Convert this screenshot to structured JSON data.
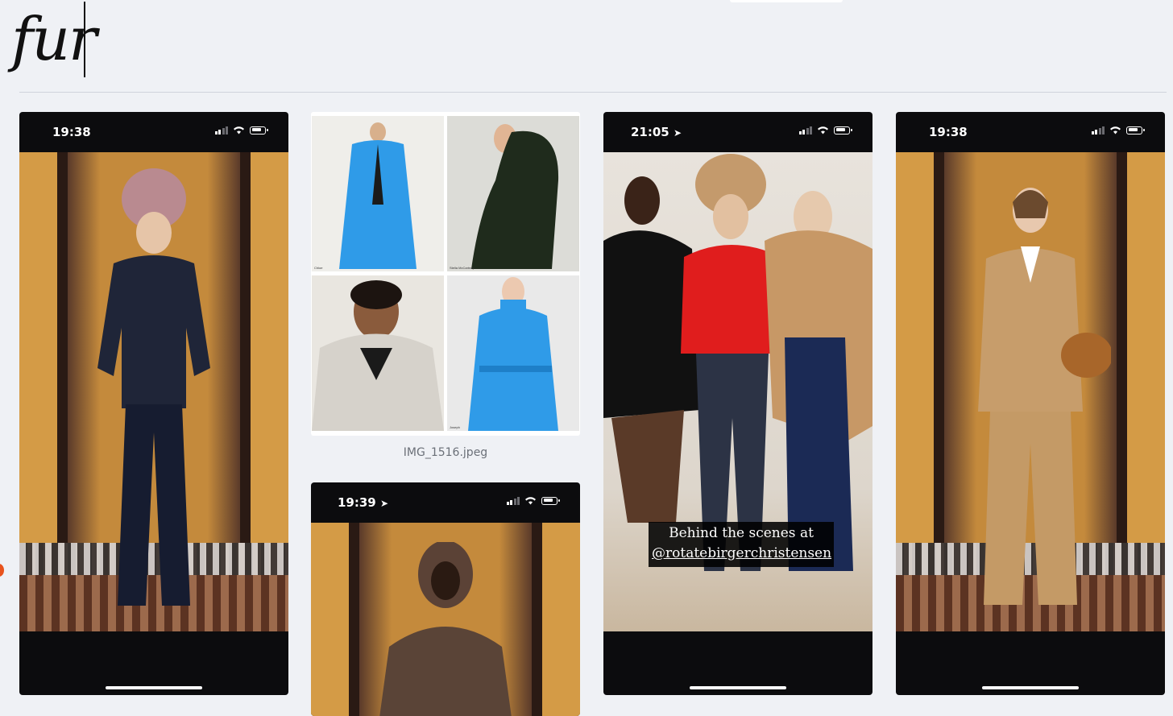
{
  "board": {
    "title": "fur",
    "collage_caption": "IMG_1516.jpeg"
  },
  "phones": [
    {
      "time": "19:38",
      "location_arrow": false
    },
    {
      "time": "19:39",
      "location_arrow": true
    },
    {
      "time": "21:05",
      "location_arrow": true
    },
    {
      "time": "19:38",
      "location_arrow": false
    }
  ],
  "story_text": {
    "line1": "Behind the scenes at",
    "line2": "@rotatebirgerchristensen"
  },
  "collage_labels": [
    "Chloe",
    "Stella McCartney",
    "Joseph"
  ],
  "colors": {
    "background": "#eff1f5",
    "phone_frame": "#0c0c0e",
    "accent_blue": "#2f9be8"
  }
}
